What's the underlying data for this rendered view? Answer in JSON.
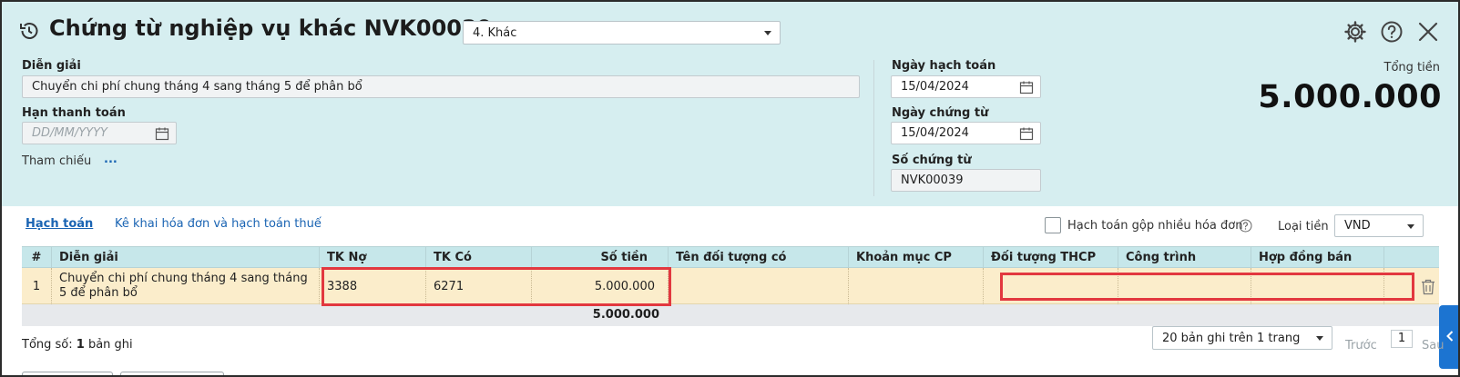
{
  "header": {
    "title": "Chứng từ nghiệp vụ khác NVK00039",
    "type_select": "4. Khác",
    "colors": {
      "background": "#d6eef0",
      "accent": "#1a64b3",
      "highlight": "#e2383f"
    }
  },
  "form": {
    "description_label": "Diễn giải",
    "description_value": "Chuyển chi phí chung tháng 4 sang tháng 5 để phân bổ",
    "due_date_label": "Hạn thanh toán",
    "due_date_placeholder": "DD/MM/YYYY",
    "reference_label": "Tham chiếu",
    "reference_link": "...",
    "posting_date_label": "Ngày hạch toán",
    "posting_date_value": "15/04/2024",
    "voucher_date_label": "Ngày chứng từ",
    "voucher_date_value": "15/04/2024",
    "voucher_no_label": "Số chứng từ",
    "voucher_no_value": "NVK00039",
    "total_label": "Tổng tiền",
    "total_value": "5.000.000"
  },
  "tabs": {
    "accounting": "Hạch toán",
    "invoice_tax": "Kê khai hóa đơn và hạch toán thuế"
  },
  "options": {
    "merge_invoices_label": "Hạch toán gộp nhiều hóa đơn",
    "merge_invoices_checked": false,
    "currency_label": "Loại tiền",
    "currency_value": "VND"
  },
  "table": {
    "columns": [
      "#",
      "Diễn giải",
      "TK Nợ",
      "TK Có",
      "Số tiền",
      "Tên đối tượng có",
      "Khoản mục CP",
      "Đối tượng THCP",
      "Công trình",
      "Hợp đồng bán"
    ],
    "rows": [
      {
        "index": "1",
        "description": "Chuyển chi phí chung tháng 4 sang tháng 5 để phân bổ",
        "debit_account": "3388",
        "credit_account": "6271",
        "amount": "5.000.000",
        "credit_object": "",
        "cost_item": "",
        "cost_object": "",
        "construction": "",
        "sales_contract": ""
      }
    ],
    "footer_total": "5.000.000"
  },
  "pager": {
    "total_prefix": "Tổng số: ",
    "total_count": "1",
    "total_suffix": " bản ghi",
    "page_size": "20 bản ghi trên 1 trang",
    "prev": "Trước",
    "page": "1",
    "next": "Sau"
  }
}
